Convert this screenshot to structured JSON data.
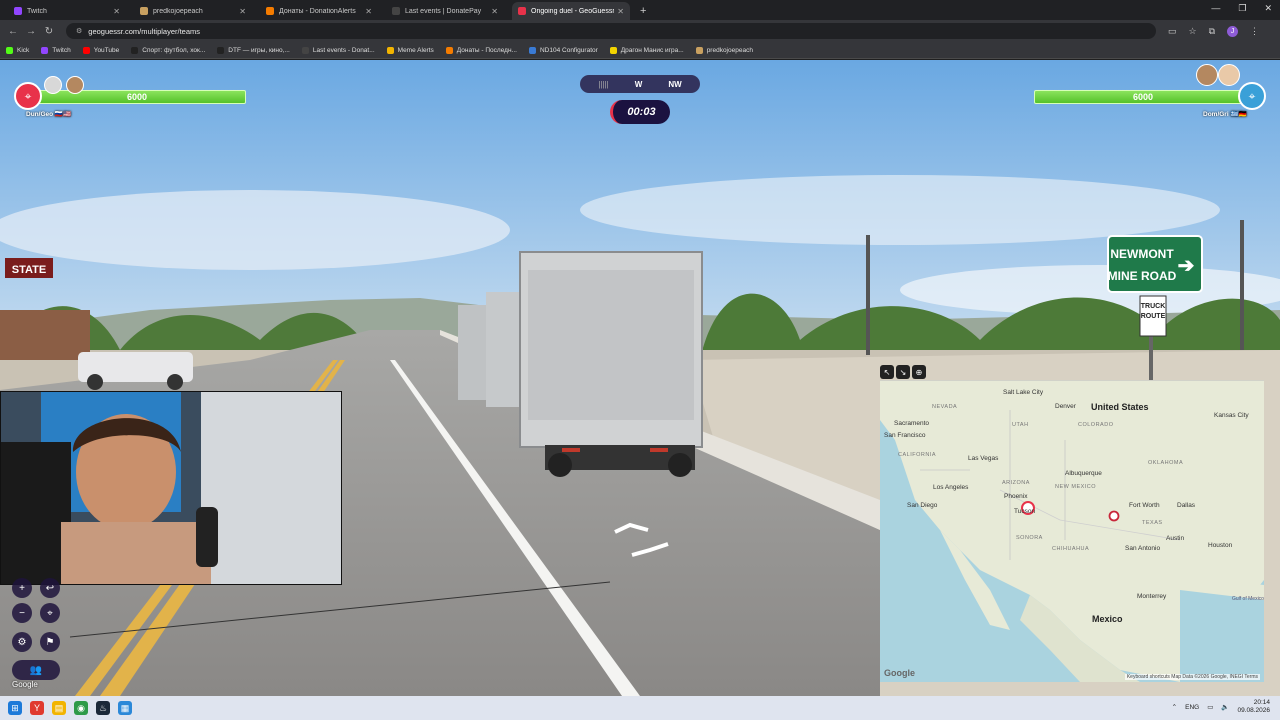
{
  "browser": {
    "tabs": [
      {
        "label": "Twitch",
        "color": "#9146ff",
        "active": false
      },
      {
        "label": "predkojoepeach",
        "color": "#c8a060",
        "active": false
      },
      {
        "label": "Донаты - DonationAlerts",
        "color": "#f57c00",
        "active": false
      },
      {
        "label": "Last events | DonatePay",
        "color": "#444444",
        "active": false
      },
      {
        "label": "Ongoing duel - GeoGuessr",
        "color": "#e8324a",
        "active": true
      }
    ],
    "url": "geoguessr.com/multiplayer/teams",
    "profile_initial": "J",
    "bookmarks": [
      {
        "label": "Kick",
        "color": "#53fc18"
      },
      {
        "label": "Twitch",
        "color": "#9146ff"
      },
      {
        "label": "YouTube",
        "color": "#ff0000"
      },
      {
        "label": "Спорт: футбол, хок...",
        "color": "#222222"
      },
      {
        "label": "DTF — игры, кино,...",
        "color": "#222222"
      },
      {
        "label": "Last events - Donat...",
        "color": "#444444"
      },
      {
        "label": "Meme Alerts",
        "color": "#f2b400"
      },
      {
        "label": "Донаты - Последн...",
        "color": "#f57c00"
      },
      {
        "label": "ND104 Configurator",
        "color": "#3a7bd5"
      },
      {
        "label": "Драгон Манис игра...",
        "color": "#f2d400"
      },
      {
        "label": "predkojoepeach",
        "color": "#c8a060"
      }
    ]
  },
  "game": {
    "left_team": {
      "hp": "6000",
      "name": "Dun/Geo",
      "color": "#e8324a"
    },
    "right_team": {
      "hp": "6000",
      "name": "Dom/Gri",
      "color": "#3aa0d8"
    },
    "compass": {
      "main": "W",
      "next": "NW"
    },
    "timer": "00:03",
    "sign": {
      "line1": "NEWMONT",
      "line2": "MINE ROAD",
      "route1": "TRUCK",
      "route2": "ROUTE"
    },
    "store_sign": "STATE",
    "google_watermark": "Google"
  },
  "map": {
    "country_labels": [
      {
        "text": "United States"
      },
      {
        "text": "Mexico"
      }
    ],
    "cities": [
      {
        "text": "Salt Lake City"
      },
      {
        "text": "Denver"
      },
      {
        "text": "Kansas City"
      },
      {
        "text": "Sacramento"
      },
      {
        "text": "San Francisco"
      },
      {
        "text": "Las Vegas"
      },
      {
        "text": "Albuquerque"
      },
      {
        "text": "Los Angeles"
      },
      {
        "text": "Phoenix"
      },
      {
        "text": "Tucson"
      },
      {
        "text": "San Diego"
      },
      {
        "text": "Fort Worth"
      },
      {
        "text": "Dallas"
      },
      {
        "text": "Austin"
      },
      {
        "text": "San Antonio"
      },
      {
        "text": "Houston"
      },
      {
        "text": "Monterrey"
      },
      {
        "text": "Gulf of Mexico"
      }
    ],
    "states": [
      {
        "text": "NEVADA"
      },
      {
        "text": "UTAH"
      },
      {
        "text": "COLORADO"
      },
      {
        "text": "CALIFORNIA"
      },
      {
        "text": "ARIZONA"
      },
      {
        "text": "NEW MEXICO"
      },
      {
        "text": "TEXAS"
      },
      {
        "text": "SONORA"
      },
      {
        "text": "CHIHUAHUA"
      },
      {
        "text": "OKLAHOMA"
      }
    ],
    "logo": "Google",
    "attribution": "Keyboard shortcuts   Map Data ©2026 Google, INEGI   Terms"
  },
  "taskbar": {
    "language": "ENG",
    "time": "20:14",
    "date": "09.08.2026"
  }
}
